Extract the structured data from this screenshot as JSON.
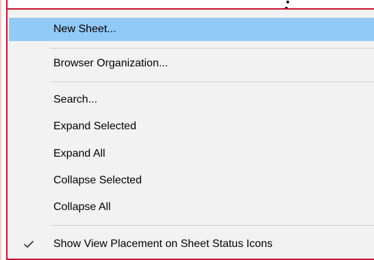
{
  "context_menu": {
    "items": [
      {
        "label": "New Sheet...",
        "highlighted": true
      },
      {
        "label": "Browser Organization..."
      },
      {
        "label": "Search..."
      },
      {
        "label": "Expand Selected"
      },
      {
        "label": "Expand All"
      },
      {
        "label": "Collapse Selected"
      },
      {
        "label": "Collapse All"
      },
      {
        "label": "Show View Placement on Sheet Status Icons",
        "checked": true,
        "icon": "checkmark-icon"
      }
    ]
  },
  "colors": {
    "highlight": "#91c9f7",
    "menu_background": "#f2f2f2",
    "annotation_border": "#c8102e",
    "separator": "#cfcfcf"
  }
}
